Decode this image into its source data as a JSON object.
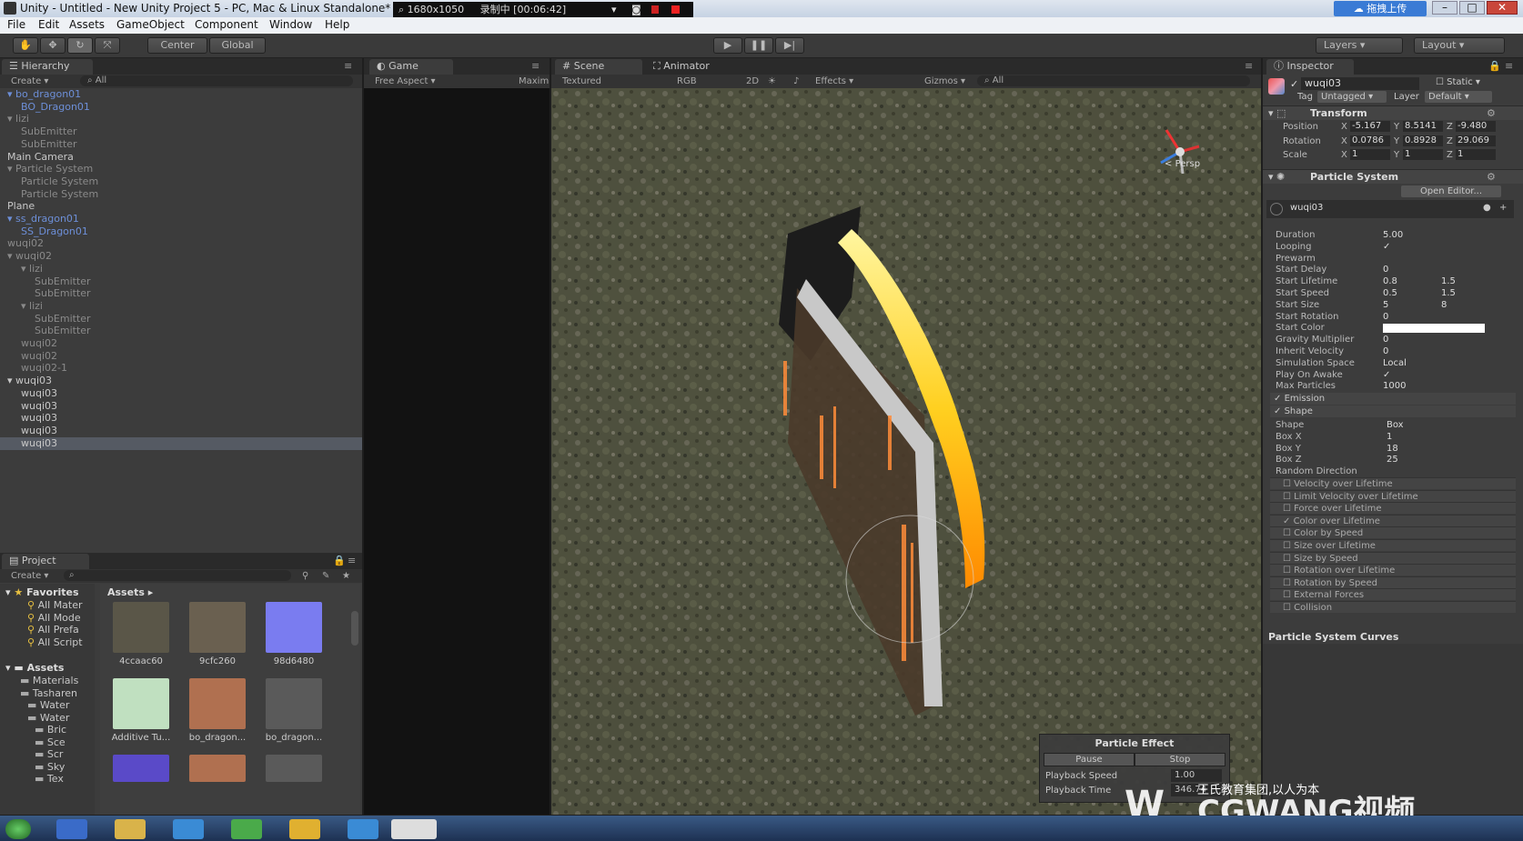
{
  "window": {
    "title": "Unity - Untitled - New Unity Project 5 - PC, Mac & Linux Standalone*",
    "recorder": {
      "resolution": "1680x1050",
      "status": "录制中 [00:06:42]"
    },
    "top_right_button": "拖拽上传"
  },
  "menu": [
    "File",
    "Edit",
    "Assets",
    "GameObject",
    "Component",
    "Window",
    "Help"
  ],
  "toolbar": {
    "center": "Center",
    "global": "Global",
    "layers": "Layers",
    "layout": "Layout"
  },
  "hierarchy": {
    "tab": "Hierarchy",
    "create": "Create",
    "search": "All",
    "rows": [
      {
        "label": "bo_dragon01",
        "indent": 0,
        "style": "blue",
        "arrow": true
      },
      {
        "label": "BO_Dragon01",
        "indent": 1,
        "style": "blue"
      },
      {
        "label": "lizi",
        "indent": 0,
        "style": "grey",
        "arrow": true
      },
      {
        "label": "SubEmitter",
        "indent": 1,
        "style": "grey"
      },
      {
        "label": "SubEmitter",
        "indent": 1,
        "style": "grey"
      },
      {
        "label": "Main Camera",
        "indent": 0,
        "style": "normal"
      },
      {
        "label": "Particle System",
        "indent": 0,
        "style": "grey",
        "arrow": true
      },
      {
        "label": "Particle System",
        "indent": 1,
        "style": "grey"
      },
      {
        "label": "Particle System",
        "indent": 1,
        "style": "grey"
      },
      {
        "label": "Plane",
        "indent": 0,
        "style": "normal"
      },
      {
        "label": "ss_dragon01",
        "indent": 0,
        "style": "blue",
        "arrow": true
      },
      {
        "label": "SS_Dragon01",
        "indent": 1,
        "style": "blue"
      },
      {
        "label": "wuqi02",
        "indent": 0,
        "style": "grey"
      },
      {
        "label": "wuqi02",
        "indent": 0,
        "style": "grey",
        "arrow": true
      },
      {
        "label": "lizi",
        "indent": 1,
        "style": "grey",
        "arrow": true
      },
      {
        "label": "SubEmitter",
        "indent": 2,
        "style": "grey"
      },
      {
        "label": "SubEmitter",
        "indent": 2,
        "style": "grey"
      },
      {
        "label": "lizi",
        "indent": 1,
        "style": "grey",
        "arrow": true
      },
      {
        "label": "SubEmitter",
        "indent": 2,
        "style": "grey"
      },
      {
        "label": "SubEmitter",
        "indent": 2,
        "style": "grey"
      },
      {
        "label": "wuqi02",
        "indent": 1,
        "style": "grey"
      },
      {
        "label": "wuqi02",
        "indent": 1,
        "style": "grey"
      },
      {
        "label": "wuqi02-1",
        "indent": 1,
        "style": "grey"
      },
      {
        "label": "wuqi03",
        "indent": 0,
        "style": "normal",
        "arrow": true
      },
      {
        "label": "wuqi03",
        "indent": 1,
        "style": "normal"
      },
      {
        "label": "wuqi03",
        "indent": 1,
        "style": "normal"
      },
      {
        "label": "wuqi03",
        "indent": 1,
        "style": "normal"
      },
      {
        "label": "wuqi03",
        "indent": 1,
        "style": "normal"
      },
      {
        "label": "wuqi03",
        "indent": 1,
        "style": "normal",
        "selected": true
      }
    ]
  },
  "project": {
    "tab": "Project",
    "create": "Create",
    "favorites_title": "Favorites",
    "favorites": [
      "All Mater",
      "All Mode",
      "All Prefa",
      "All Script"
    ],
    "assets_title": "Assets",
    "tree": [
      "Materials",
      "Tasharen",
      "Water",
      "Water",
      "Bric",
      "Sce",
      "Scr",
      "Sky",
      "Tex"
    ],
    "breadcrumb": "Assets",
    "items": [
      {
        "caption": "4ccaac60",
        "color": "#5a5648"
      },
      {
        "caption": "9cfc260",
        "color": "#6a6050"
      },
      {
        "caption": "98d6480",
        "color": "#7a7cf0"
      },
      {
        "caption": "Additive Tu...",
        "color": "#c0e0c0"
      },
      {
        "caption": "bo_dragon...",
        "color": "#b07050"
      },
      {
        "caption": "bo_dragon...",
        "color": "#5a5a5a"
      }
    ]
  },
  "game": {
    "tab": "Game",
    "aspect": "Free Aspect",
    "maximize": "Maxim"
  },
  "scene": {
    "tab": "Scene",
    "animator_tab": "Animator",
    "shading": "Textured",
    "rgb": "RGB",
    "mode_2d": "2D",
    "effects": "Effects",
    "gizmos": "Gizmos",
    "search": "All",
    "persp": "Persp",
    "particle_effect": {
      "title": "Particle Effect",
      "pause": "Pause",
      "stop": "Stop",
      "playback_speed_label": "Playback Speed",
      "playback_speed": "1.00",
      "playback_time_label": "Playback Time",
      "playback_time": "346.74"
    }
  },
  "inspector": {
    "tab": "Inspector",
    "object_name": "wuqi03",
    "static": "Static",
    "tag_label": "Tag",
    "tag": "Untagged",
    "layer_label": "Layer",
    "layer": "Default",
    "transform": {
      "title": "Transform",
      "position_label": "Position",
      "position": {
        "x": "-5.167",
        "y": "8.5141",
        "z": "-9.480"
      },
      "rotation_label": "Rotation",
      "rotation": {
        "x": "0.0786",
        "y": "0.8928",
        "z": "29.069"
      },
      "scale_label": "Scale",
      "scale": {
        "x": "1",
        "y": "1",
        "z": "1"
      }
    },
    "particle_system": {
      "title": "Particle System",
      "open_editor": "Open Editor...",
      "name": "wuqi03",
      "props": [
        {
          "label": "Duration",
          "v1": "5.00"
        },
        {
          "label": "Looping",
          "v1": "✓"
        },
        {
          "label": "Prewarm",
          "v1": ""
        },
        {
          "label": "Start Delay",
          "v1": "0"
        },
        {
          "label": "Start Lifetime",
          "v1": "0.8",
          "v2": "1.5"
        },
        {
          "label": "Start Speed",
          "v1": "0.5",
          "v2": "1.5"
        },
        {
          "label": "Start Size",
          "v1": "5",
          "v2": "8"
        },
        {
          "label": "Start Rotation",
          "v1": "0"
        },
        {
          "label": "Start Color",
          "v1": ""
        },
        {
          "label": "Gravity Multiplier",
          "v1": "0"
        },
        {
          "label": "Inherit Velocity",
          "v1": "0"
        },
        {
          "label": "Simulation Space",
          "v1": "Local"
        },
        {
          "label": "Play On Awake",
          "v1": "✓"
        },
        {
          "label": "Max Particles",
          "v1": "1000"
        }
      ],
      "emission": "Emission",
      "shape": "Shape",
      "shape_props": [
        {
          "label": "Shape",
          "v1": "Box"
        },
        {
          "label": "Box X",
          "v1": "1"
        },
        {
          "label": "Box Y",
          "v1": "18"
        },
        {
          "label": "Box Z",
          "v1": "25"
        },
        {
          "label": "Random Direction",
          "v1": ""
        }
      ],
      "modules": [
        {
          "label": "Velocity over Lifetime",
          "checked": false
        },
        {
          "label": "Limit Velocity over Lifetime",
          "checked": false
        },
        {
          "label": "Force over Lifetime",
          "checked": false
        },
        {
          "label": "Color over Lifetime",
          "checked": true
        },
        {
          "label": "Color by Speed",
          "checked": false
        },
        {
          "label": "Size over Lifetime",
          "checked": false
        },
        {
          "label": "Size by Speed",
          "checked": false
        },
        {
          "label": "Rotation over Lifetime",
          "checked": false
        },
        {
          "label": "Rotation by Speed",
          "checked": false
        },
        {
          "label": "External Forces",
          "checked": false
        },
        {
          "label": "Collision",
          "checked": false
        }
      ],
      "curves_title": "Particle System Curves"
    }
  },
  "watermark": {
    "line1": "王氏教育集团,以人为本",
    "line2": "CGWANG视频"
  }
}
